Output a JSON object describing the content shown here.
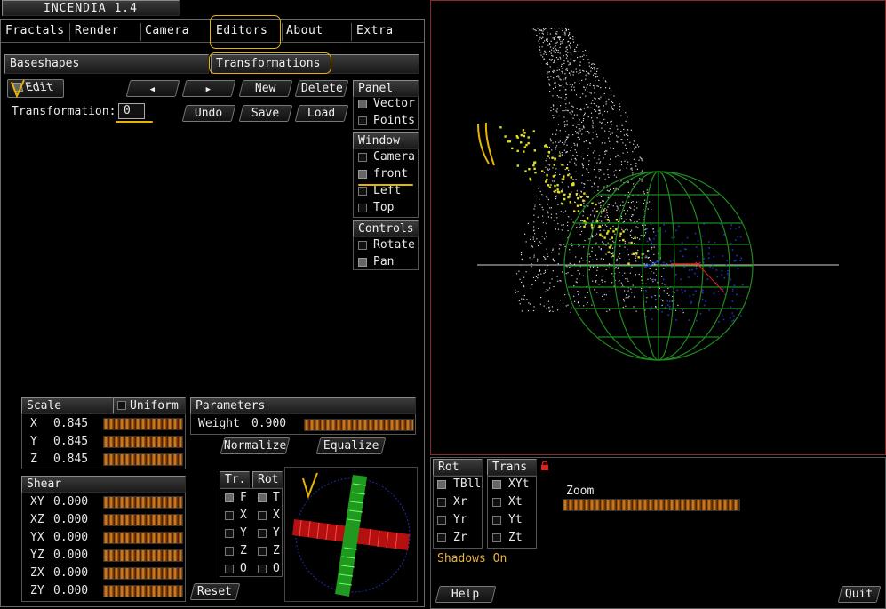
{
  "app": {
    "title": "INCENDIA 1.4"
  },
  "menu": [
    "Fractals",
    "Render",
    "Camera",
    "Editors",
    "About",
    "Extra"
  ],
  "subtabs": {
    "baseshapes": "Baseshapes",
    "transformations": "Transformations"
  },
  "toolbar": {
    "edit": "Edit",
    "prev_icon": "◀",
    "next_icon": "▶",
    "new": "New",
    "delete": "Delete",
    "undo": "Undo",
    "save": "Save",
    "load": "Load",
    "transformation_label": "Transformation:",
    "transformation_value": "0"
  },
  "panel_group": {
    "title": "Panel",
    "items": [
      {
        "label": "Vector",
        "checked": true
      },
      {
        "label": "Points",
        "checked": false
      }
    ]
  },
  "window_group": {
    "title": "Window",
    "items": [
      {
        "label": "Camera",
        "checked": false
      },
      {
        "label": "front",
        "checked": true
      },
      {
        "label": "Left",
        "checked": false
      },
      {
        "label": "Top",
        "checked": false
      }
    ]
  },
  "controls_group": {
    "title": "Controls",
    "items": [
      {
        "label": "Rotate",
        "checked": false
      },
      {
        "label": "Pan",
        "checked": true
      }
    ]
  },
  "scale": {
    "title": "Scale",
    "uniform": "Uniform",
    "rows": [
      {
        "axis": "X",
        "value": "0.845"
      },
      {
        "axis": "Y",
        "value": "0.845"
      },
      {
        "axis": "Z",
        "value": "0.845"
      }
    ]
  },
  "shear": {
    "title": "Shear",
    "rows": [
      {
        "axis": "XY",
        "value": "0.000"
      },
      {
        "axis": "XZ",
        "value": "0.000"
      },
      {
        "axis": "YX",
        "value": "0.000"
      },
      {
        "axis": "YZ",
        "value": "0.000"
      },
      {
        "axis": "ZX",
        "value": "0.000"
      },
      {
        "axis": "ZY",
        "value": "0.000"
      }
    ]
  },
  "parameters": {
    "title": "Parameters",
    "weight_label": "Weight",
    "weight_value": "0.900",
    "normalize": "Normalize",
    "equalize": "Equalize"
  },
  "tr_rot": {
    "tr": "Tr.",
    "rot": "Rot",
    "tr_items": [
      "F",
      "X",
      "Y",
      "Z",
      "O"
    ],
    "rot_items": [
      "T",
      "X",
      "Y",
      "Z",
      "O"
    ],
    "reset": "Reset"
  },
  "view_controls": {
    "rot": "Rot",
    "trans": "Trans",
    "rot_items": [
      {
        "label": "TBll",
        "checked": true
      },
      {
        "label": "Xr",
        "checked": false
      },
      {
        "label": "Yr",
        "checked": false
      },
      {
        "label": "Zr",
        "checked": false
      }
    ],
    "trans_items": [
      {
        "label": "XYt",
        "checked": true
      },
      {
        "label": "Xt",
        "checked": false
      },
      {
        "label": "Yt",
        "checked": false
      },
      {
        "label": "Zt",
        "checked": false
      }
    ],
    "zoom": "Zoom",
    "shadows": "Shadows On",
    "help": "Help",
    "quit": "Quit"
  },
  "colors": {
    "accent": "#e8b400",
    "slider": "#e08a28",
    "sphere": "#1f8a1f",
    "points_white": "#d8d8d8",
    "points_yellow": "#e0e020",
    "points_blue": "#2233cc"
  }
}
